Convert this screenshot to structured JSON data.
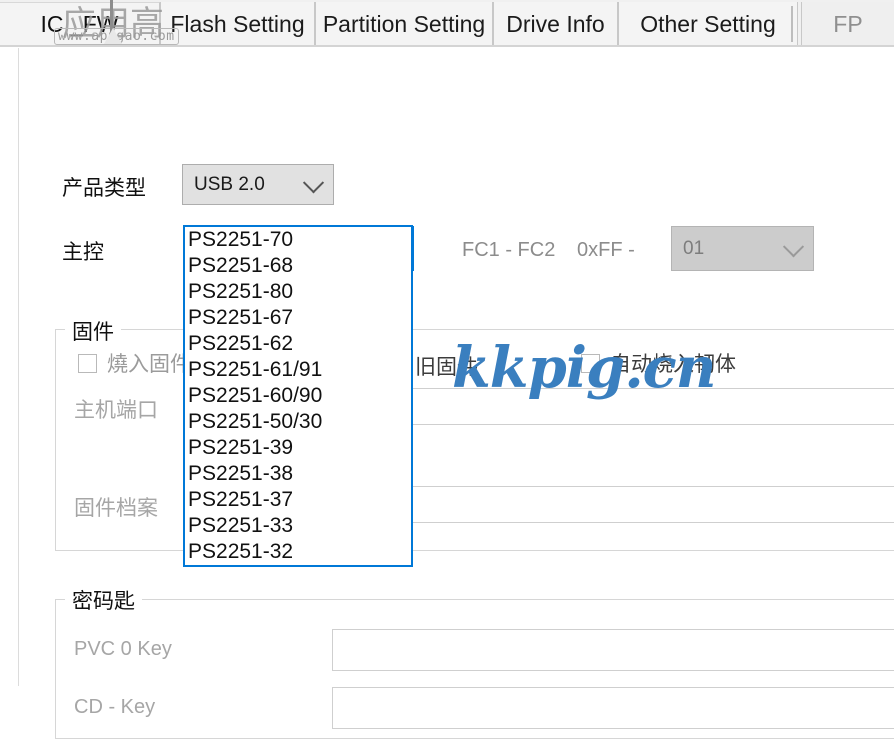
{
  "tabs": [
    {
      "label": "IC _FW",
      "state": "selected"
    },
    {
      "label": "Flash Setting",
      "state": "normal"
    },
    {
      "label": "Partition Setting",
      "state": "normal"
    },
    {
      "label": "Drive Info",
      "state": "normal"
    },
    {
      "label": "Other Setting",
      "state": "normal"
    },
    {
      "label": "FP",
      "state": "inactive"
    }
  ],
  "form": {
    "product_type_label": "产品类型",
    "product_type_value": "USB 2.0",
    "controller_label": "主控",
    "controller_value": "",
    "fc_range_text": "FC1 - FC2",
    "fc_prefix_text": "0xFF -",
    "fc_value": "01"
  },
  "firmware_group": {
    "title": "固件",
    "burn_firmware_label": "燒入固件",
    "old_firmware_label": "旧固件",
    "auto_burn_label": "自动烧入韧体",
    "host_port_label": "主机端口",
    "firmware_file_label": "固件档案",
    "host_port_value": "",
    "firmware_file_value": ""
  },
  "key_group": {
    "title": "密码匙",
    "pvc_key_label": "PVC 0 Key",
    "cd_key_label": "CD - Key",
    "pvc_key_value": "",
    "cd_key_value": ""
  },
  "controller_options": [
    "PS2251-70",
    "PS2251-68",
    "PS2251-80",
    "PS2251-67",
    "PS2251-62",
    "PS2251-61/91",
    "PS2251-60/90",
    "PS2251-50/30",
    "PS2251-39",
    "PS2251-38",
    "PS2251-37",
    "PS2251-33",
    "PS2251-32"
  ],
  "watermarks": {
    "primary": "kkpig.cn",
    "overlay_cn": "应用高",
    "overlay_url": "www.appgao.com"
  },
  "colors": {
    "accent": "#0078d7",
    "dropdown_highlight": "#cce4f7",
    "watermark_blue": "#3a7fbf",
    "disabled_text": "#a6a6a6"
  }
}
